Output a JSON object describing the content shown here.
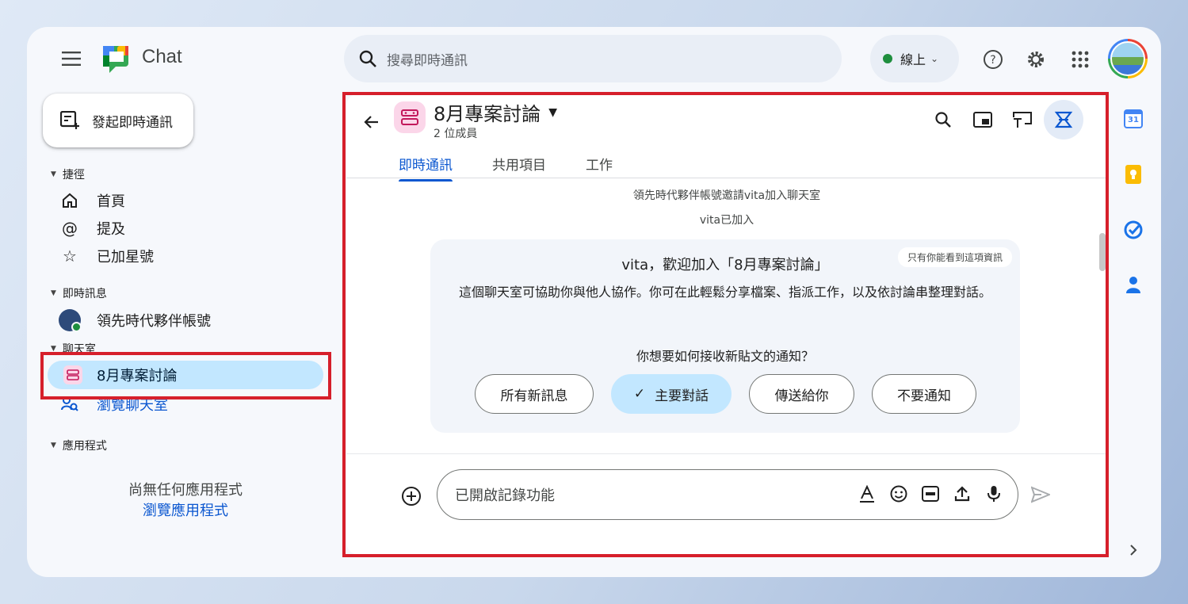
{
  "app": {
    "title": "Chat"
  },
  "search": {
    "placeholder": "搜尋即時通訊"
  },
  "status": {
    "label": "線上"
  },
  "sidebar": {
    "compose_label": "發起即時通訊",
    "shortcuts": {
      "title": "捷徑",
      "items": [
        {
          "label": "首頁"
        },
        {
          "label": "提及"
        },
        {
          "label": "已加星號"
        }
      ]
    },
    "dms": {
      "title": "即時訊息",
      "items": [
        {
          "label": "領先時代夥伴帳號"
        }
      ]
    },
    "rooms": {
      "title": "聊天室",
      "items": [
        {
          "label": "8月專案討論"
        }
      ],
      "browse_label": "瀏覽聊天室"
    },
    "apps": {
      "title": "應用程式",
      "empty_text": "尚無任何應用程式",
      "browse_label": "瀏覽應用程式"
    }
  },
  "room": {
    "name": "8月專案討論",
    "members": "2 位成員",
    "tabs": [
      {
        "label": "即時通訊"
      },
      {
        "label": "共用項目"
      },
      {
        "label": "工作"
      }
    ],
    "system_messages": [
      "領先時代夥伴帳號邀請vita加入聊天室",
      "vita已加入"
    ],
    "welcome": {
      "title": "vita，歡迎加入「8月專案討論」",
      "only_you": "只有你能看到這項資訊",
      "description": "這個聊天室可協助你與他人協作。你可在此輕鬆分享檔案、指派工作，以及依討論串整理對話。",
      "question": "你想要如何接收新貼文的通知？",
      "options": [
        {
          "label": "所有新訊息"
        },
        {
          "label": "主要對話",
          "check": "✓"
        },
        {
          "label": "傳送給你"
        },
        {
          "label": "不要通知"
        }
      ]
    },
    "composer": {
      "placeholder": "已開啟記錄功能"
    }
  },
  "rail": {
    "calendar_day": "31"
  },
  "colors": {
    "accent": "#0b57d0",
    "highlight": "#c2e7ff",
    "annotation": "#d61f2b",
    "online": "#1e8e3e"
  }
}
